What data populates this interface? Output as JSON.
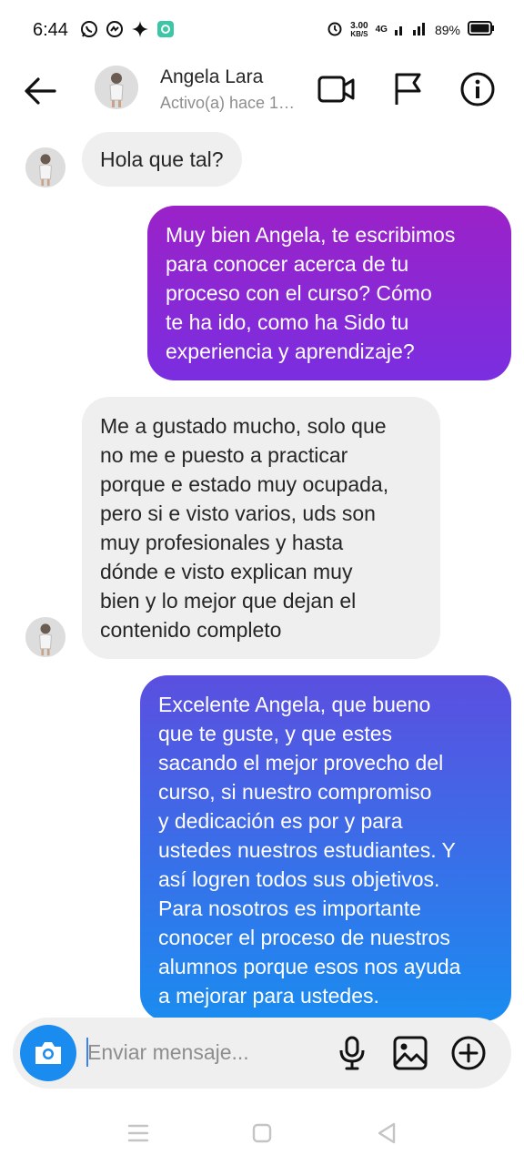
{
  "status_bar": {
    "time": "6:44",
    "speed_value": "3.00",
    "speed_unit": "KB/S",
    "network": "4G",
    "battery": "89%"
  },
  "header": {
    "contact_name": "Angela Lara",
    "contact_status": "Activo(a) hace 1…"
  },
  "messages": [
    {
      "direction": "incoming",
      "lines": [
        "Hola que tal?"
      ]
    },
    {
      "direction": "outgoing",
      "lines": [
        "Muy bien Angela, te escribimos",
        "para conocer acerca de tu",
        "proceso con el curso? Cómo",
        "te ha ido, como ha Sido tu",
        "experiencia y aprendizaje?"
      ]
    },
    {
      "direction": "incoming",
      "lines": [
        "Me a gustado mucho, solo que",
        "no me e puesto a practicar",
        "porque e estado muy ocupada,",
        "pero si e visto varios, uds son",
        "muy profesionales y hasta",
        "dónde e visto explican muy",
        "bien y lo mejor que dejan el",
        "contenido completo"
      ]
    },
    {
      "direction": "outgoing",
      "lines": [
        "Excelente Angela, que bueno",
        "que te guste, y que estes",
        "sacando el mejor provecho del",
        "curso, si nuestro compromiso",
        "y dedicación es por y para",
        "ustedes nuestros estudiantes. Y",
        "así logren todos sus objetivos.",
        "Para nosotros es importante",
        "conocer el proceso de nuestros",
        "alumnos porque esos nos ayuda",
        "a mejorar para ustedes."
      ]
    }
  ],
  "composer": {
    "placeholder": "Enviar mensaje..."
  },
  "colors": {
    "outgoing_1_gradient": [
      "#9b22c8",
      "#7a2ee0"
    ],
    "outgoing_2_gradient": [
      "#5b4fe0",
      "#1a8cf0"
    ],
    "incoming_bubble": "#efefef",
    "accent": "#1a8cf0"
  },
  "icons": {
    "status_left": [
      "whatsapp-icon",
      "messenger-icon",
      "sparkle-icon",
      "app-icon"
    ],
    "header": [
      "back-arrow-icon",
      "video-call-icon",
      "flag-icon",
      "info-icon"
    ],
    "composer": [
      "camera-icon",
      "microphone-icon",
      "gallery-icon",
      "plus-icon"
    ],
    "nav": [
      "menu-icon",
      "home-icon",
      "back-icon"
    ]
  }
}
